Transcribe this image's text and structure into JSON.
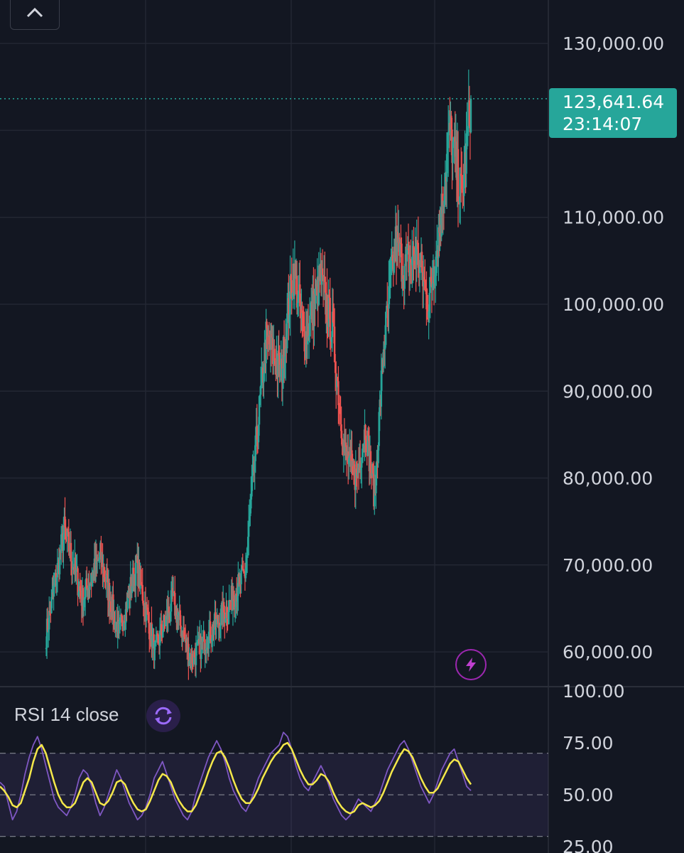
{
  "chart_data": [
    {
      "type": "candlestick",
      "title": "",
      "y_axis": {
        "ticks": [
          60000,
          70000,
          80000,
          90000,
          100000,
          110000,
          130000
        ],
        "tick_labels": [
          "60,000.00",
          "70,000.00",
          "80,000.00",
          "90,000.00",
          "100,000.00",
          "110,000.00",
          "130,000.00"
        ],
        "ylim": [
          56000,
          135000
        ]
      },
      "last_price": 123641.64,
      "last_price_label": "123,641.64",
      "countdown_label": "23:14:07",
      "grid": true,
      "trend_anchors": [
        [
          0,
          62000
        ],
        [
          6,
          74000
        ],
        [
          12,
          66000
        ],
        [
          18,
          71000
        ],
        [
          24,
          62000
        ],
        [
          30,
          70000
        ],
        [
          36,
          60000
        ],
        [
          42,
          66000
        ],
        [
          48,
          59000
        ],
        [
          54,
          62000
        ],
        [
          60,
          65000
        ],
        [
          66,
          69000
        ],
        [
          70,
          85000
        ],
        [
          73,
          96000
        ],
        [
          78,
          92000
        ],
        [
          82,
          104000
        ],
        [
          86,
          96000
        ],
        [
          91,
          103000
        ],
        [
          95,
          97000
        ],
        [
          99,
          83000
        ],
        [
          103,
          80000
        ],
        [
          106,
          86000
        ],
        [
          109,
          78000
        ],
        [
          112,
          95000
        ],
        [
          116,
          107000
        ],
        [
          119,
          104000
        ],
        [
          123,
          106000
        ],
        [
          127,
          100000
        ],
        [
          131,
          110000
        ],
        [
          134,
          120000
        ],
        [
          138,
          112000
        ],
        [
          141,
          123641
        ]
      ],
      "colors": {
        "up": "#26a69a",
        "down": "#ef5350"
      }
    },
    {
      "type": "line",
      "legend": "RSI 14 close",
      "y_axis": {
        "ticks": [
          100,
          75,
          50,
          25
        ],
        "tick_labels": [
          "100.00",
          "75.00",
          "50.00",
          "25.00"
        ],
        "ylim": [
          22,
          102
        ]
      },
      "band": [
        30,
        70
      ],
      "series": [
        {
          "name": "RSI",
          "color": "#7e57c2",
          "values": [
            56,
            54,
            46,
            38,
            42,
            50,
            60,
            68,
            74,
            78,
            72,
            64,
            56,
            48,
            44,
            42,
            40,
            44,
            50,
            58,
            62,
            60,
            54,
            46,
            40,
            44,
            50,
            56,
            62,
            58,
            52,
            46,
            42,
            38,
            40,
            44,
            50,
            58,
            62,
            66,
            60,
            54,
            48,
            44,
            40,
            38,
            42,
            50,
            56,
            62,
            68,
            72,
            76,
            72,
            66,
            58,
            52,
            48,
            44,
            42,
            46,
            52,
            58,
            62,
            66,
            70,
            72,
            74,
            80,
            78,
            72,
            64,
            58,
            54,
            52,
            56,
            60,
            64,
            60,
            54,
            48,
            44,
            40,
            38,
            40,
            44,
            48,
            46,
            44,
            42,
            46,
            50,
            56,
            62,
            66,
            70,
            74,
            76,
            72,
            66,
            60,
            54,
            50,
            46,
            50,
            56,
            62,
            66,
            70,
            72,
            66,
            60,
            54,
            52
          ]
        },
        {
          "name": "MA",
          "color": "#f5e84a",
          "values": [
            54,
            52,
            49,
            45,
            44,
            46,
            52,
            58,
            66,
            72,
            74,
            70,
            63,
            56,
            50,
            46,
            44,
            44,
            46,
            51,
            56,
            58,
            56,
            51,
            46,
            45,
            47,
            51,
            56,
            57,
            55,
            50,
            46,
            43,
            42,
            43,
            47,
            52,
            57,
            60,
            59,
            56,
            51,
            47,
            44,
            42,
            42,
            45,
            50,
            55,
            61,
            66,
            70,
            71,
            68,
            63,
            57,
            52,
            48,
            46,
            46,
            49,
            53,
            58,
            62,
            66,
            69,
            71,
            74,
            75,
            72,
            67,
            62,
            58,
            55,
            55,
            57,
            60,
            59,
            56,
            51,
            47,
            44,
            42,
            41,
            42,
            45,
            46,
            45,
            44,
            45,
            47,
            51,
            56,
            61,
            65,
            69,
            72,
            71,
            68,
            63,
            58,
            54,
            51,
            51,
            53,
            57,
            61,
            65,
            67,
            66,
            62,
            58,
            55
          ]
        }
      ]
    }
  ],
  "ui": {
    "price_tag_value": "123,641.64",
    "price_tag_timer": "23:14:07",
    "rsi_legend": "RSI 14 close",
    "icons": [
      "chevron-up-icon",
      "refresh-icon",
      "lightning-icon"
    ],
    "accent_color": "#26a69a",
    "rsi_color": "#7e57c2"
  }
}
